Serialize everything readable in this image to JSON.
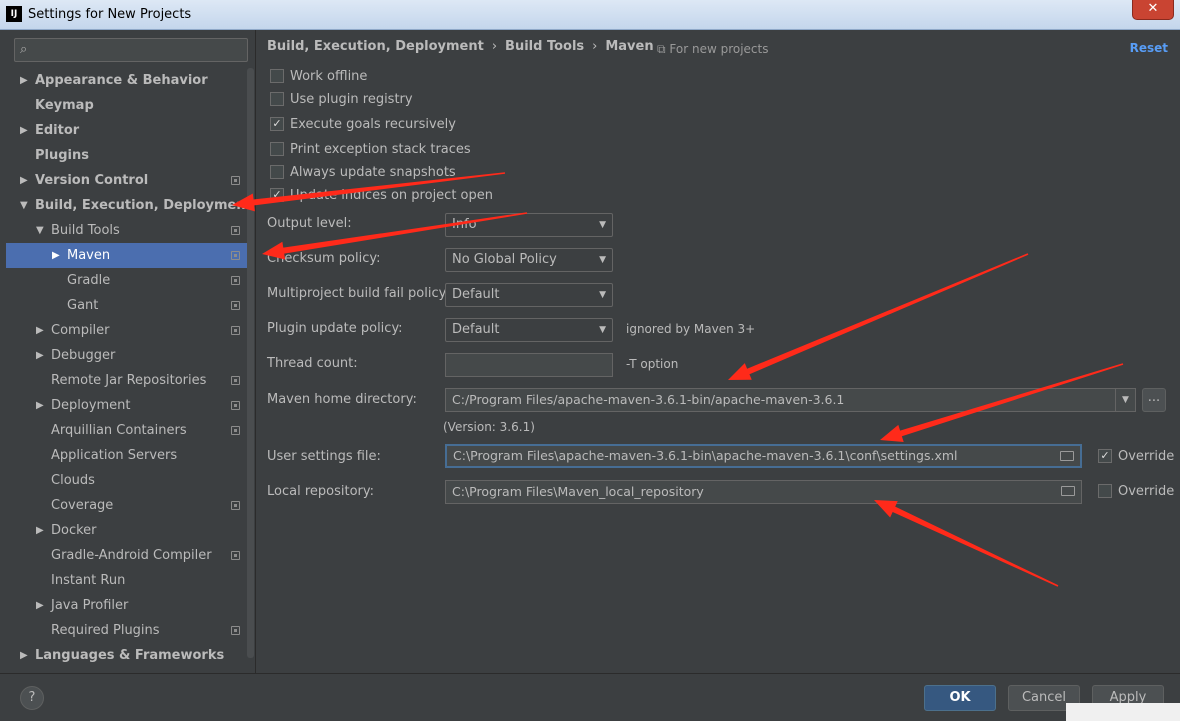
{
  "window": {
    "title": "Settings for New Projects",
    "app_icon": "IJ",
    "close_glyph": "✕"
  },
  "search": {
    "placeholder": "",
    "value": ""
  },
  "tree": [
    {
      "label": "Appearance & Behavior",
      "level": 0,
      "arrow": "▶",
      "bold": true,
      "icon": false,
      "selected": false
    },
    {
      "label": "Keymap",
      "level": 0,
      "arrow": "",
      "bold": true,
      "icon": false,
      "selected": false
    },
    {
      "label": "Editor",
      "level": 0,
      "arrow": "▶",
      "bold": true,
      "icon": false,
      "selected": false
    },
    {
      "label": "Plugins",
      "level": 0,
      "arrow": "",
      "bold": true,
      "icon": false,
      "selected": false
    },
    {
      "label": "Version Control",
      "level": 0,
      "arrow": "▶",
      "bold": true,
      "icon": true,
      "selected": false
    },
    {
      "label": "Build, Execution, Deployment",
      "level": 0,
      "arrow": "▼",
      "bold": true,
      "icon": false,
      "selected": false
    },
    {
      "label": "Build Tools",
      "level": 1,
      "arrow": "▼",
      "bold": false,
      "icon": true,
      "selected": false
    },
    {
      "label": "Maven",
      "level": 2,
      "arrow": "▶",
      "bold": false,
      "icon": true,
      "selected": true
    },
    {
      "label": "Gradle",
      "level": 2,
      "arrow": "",
      "bold": false,
      "icon": true,
      "selected": false
    },
    {
      "label": "Gant",
      "level": 2,
      "arrow": "",
      "bold": false,
      "icon": true,
      "selected": false
    },
    {
      "label": "Compiler",
      "level": 1,
      "arrow": "▶",
      "bold": false,
      "icon": true,
      "selected": false
    },
    {
      "label": "Debugger",
      "level": 1,
      "arrow": "▶",
      "bold": false,
      "icon": false,
      "selected": false
    },
    {
      "label": "Remote Jar Repositories",
      "level": 1,
      "arrow": "",
      "bold": false,
      "icon": true,
      "selected": false
    },
    {
      "label": "Deployment",
      "level": 1,
      "arrow": "▶",
      "bold": false,
      "icon": true,
      "selected": false
    },
    {
      "label": "Arquillian Containers",
      "level": 1,
      "arrow": "",
      "bold": false,
      "icon": true,
      "selected": false
    },
    {
      "label": "Application Servers",
      "level": 1,
      "arrow": "",
      "bold": false,
      "icon": false,
      "selected": false
    },
    {
      "label": "Clouds",
      "level": 1,
      "arrow": "",
      "bold": false,
      "icon": false,
      "selected": false
    },
    {
      "label": "Coverage",
      "level": 1,
      "arrow": "",
      "bold": false,
      "icon": true,
      "selected": false
    },
    {
      "label": "Docker",
      "level": 1,
      "arrow": "▶",
      "bold": false,
      "icon": false,
      "selected": false
    },
    {
      "label": "Gradle-Android Compiler",
      "level": 1,
      "arrow": "",
      "bold": false,
      "icon": true,
      "selected": false
    },
    {
      "label": "Instant Run",
      "level": 1,
      "arrow": "",
      "bold": false,
      "icon": false,
      "selected": false
    },
    {
      "label": "Java Profiler",
      "level": 1,
      "arrow": "▶",
      "bold": false,
      "icon": false,
      "selected": false
    },
    {
      "label": "Required Plugins",
      "level": 1,
      "arrow": "",
      "bold": false,
      "icon": true,
      "selected": false
    },
    {
      "label": "Languages & Frameworks",
      "level": 0,
      "arrow": "▶",
      "bold": true,
      "icon": false,
      "selected": false
    }
  ],
  "header": {
    "crumb1": "Build, Execution, Deployment",
    "crumb2": "Build Tools",
    "crumb3": "Maven",
    "separator": "›",
    "for_new": "For new projects",
    "for_new_icon": "⧉",
    "reset": "Reset"
  },
  "options": {
    "work_offline": {
      "label": "Work offline",
      "checked": false
    },
    "plugin_registry": {
      "label": "Use plugin registry",
      "checked": false
    },
    "execute_goals": {
      "label": "Execute goals recursively",
      "checked": true
    },
    "print_exception": {
      "label": "Print exception stack traces",
      "checked": false
    },
    "update_snapshots": {
      "label": "Always update snapshots",
      "checked": false
    },
    "update_indices": {
      "label": "Update indices on project open",
      "checked": true
    }
  },
  "check_glyph": "✓",
  "fields": {
    "output_level": {
      "label": "Output level:",
      "value": "Info"
    },
    "checksum_policy": {
      "label": "Checksum policy:",
      "value": "No Global Policy"
    },
    "fail_policy": {
      "label": "Multiproject build fail policy:",
      "value": "Default"
    },
    "plugin_update": {
      "label": "Plugin update policy:",
      "value": "Default",
      "hint": "ignored by Maven 3+"
    },
    "thread_count": {
      "label": "Thread count:",
      "value": "",
      "hint": "-T option"
    },
    "maven_home": {
      "label": "Maven home directory:",
      "value": "C:/Program Files/apache-maven-3.6.1-bin/apache-maven-3.6.1",
      "version": "(Version: 3.6.1)",
      "browse": "..."
    },
    "user_settings": {
      "label": "User settings file:",
      "value": "C:\\Program Files\\apache-maven-3.6.1-bin\\apache-maven-3.6.1\\conf\\settings.xml",
      "override_label": "Override",
      "override_checked": true
    },
    "local_repo": {
      "label": "Local repository:",
      "value": "C:\\Program Files\\Maven_local_repository",
      "override_label": "Override",
      "override_checked": false
    }
  },
  "caret_glyph": "▼",
  "footer": {
    "help": "?",
    "ok": "OK",
    "cancel": "Cancel",
    "apply": "Apply"
  },
  "colors": {
    "selection": "#4b6eaf",
    "accent_link": "#589df6",
    "annotation_arrow": "#ff2a1a"
  }
}
